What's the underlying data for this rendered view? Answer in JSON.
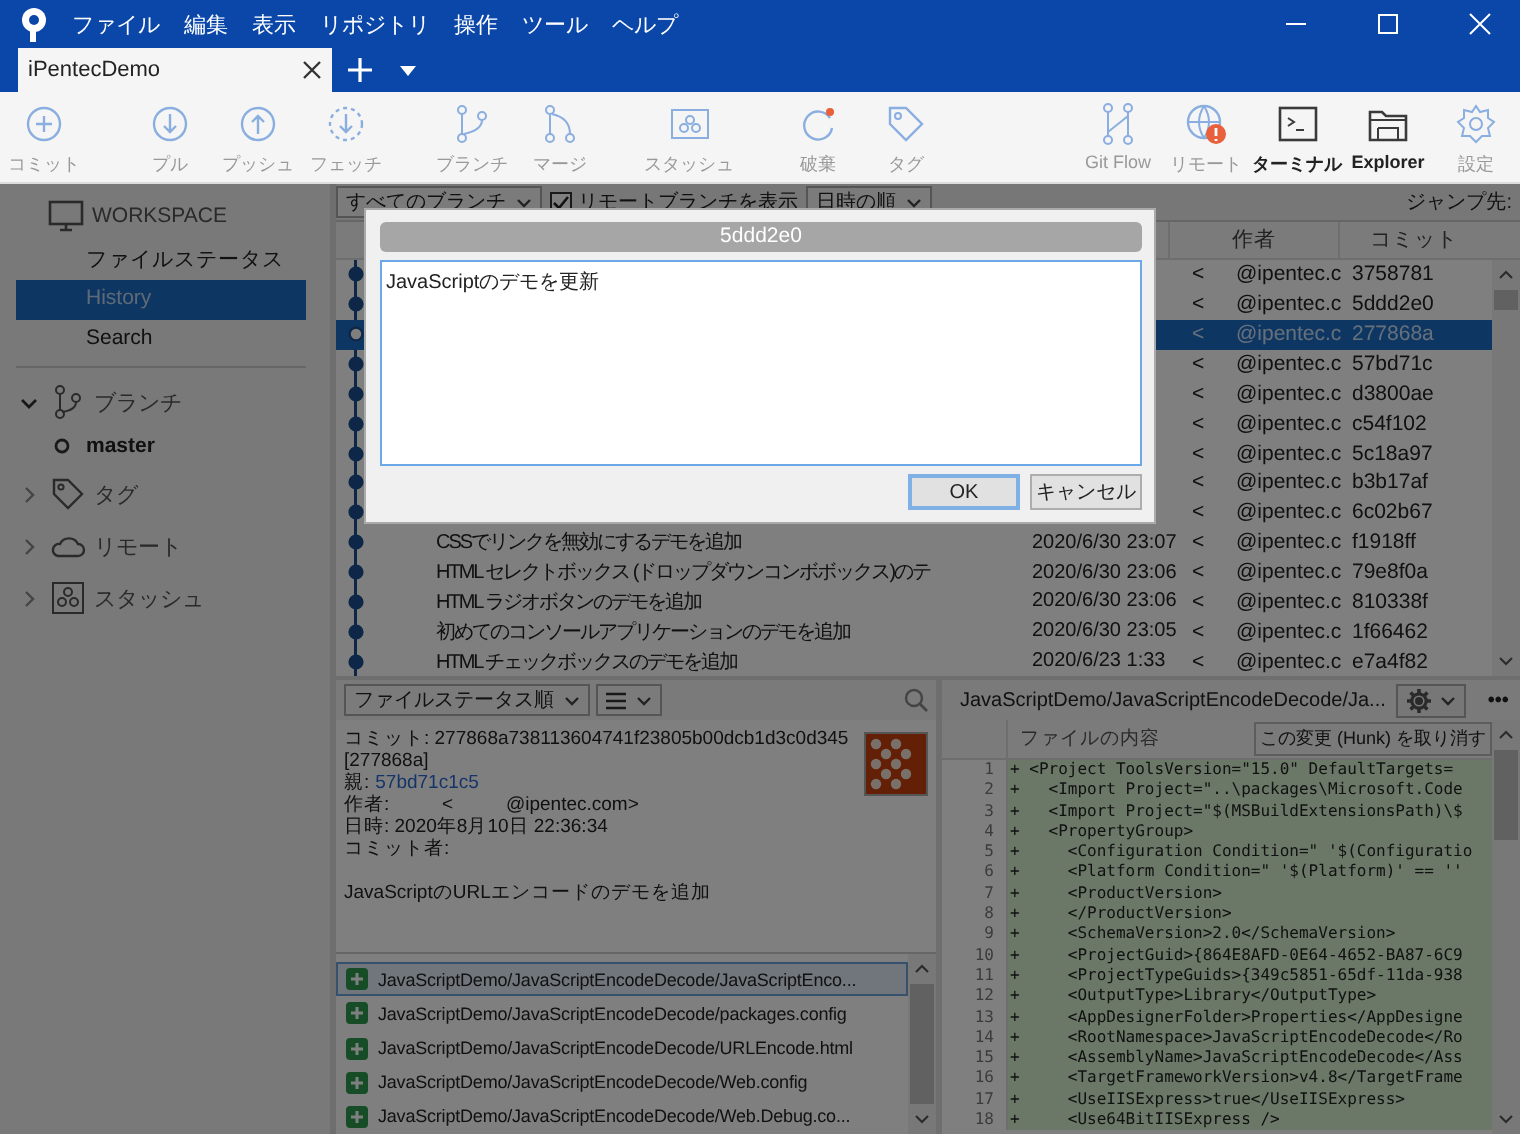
{
  "window": {
    "menu": [
      "ファイル",
      "編集",
      "表示",
      "リポジトリ",
      "操作",
      "ツール",
      "ヘルプ"
    ],
    "tabs": [
      {
        "label": "iPentecDemo",
        "selected": true
      }
    ]
  },
  "toolbar": {
    "left_groups": [
      [
        {
          "label": "コミット",
          "disabled": true
        }
      ],
      [
        {
          "label": "プル",
          "disabled": true
        },
        {
          "label": "プッシュ",
          "disabled": true
        },
        {
          "label": "フェッチ",
          "disabled": true
        }
      ],
      [
        {
          "label": "ブランチ",
          "disabled": true
        },
        {
          "label": "マージ",
          "disabled": true
        }
      ],
      [
        {
          "label": "スタッシュ",
          "disabled": true
        }
      ],
      [
        {
          "label": "破棄",
          "disabled": true
        },
        {
          "label": "タグ",
          "disabled": true
        }
      ]
    ],
    "right_groups": [
      [
        {
          "label": "Git Flow",
          "disabled": true
        },
        {
          "label": "リモート",
          "disabled": true
        },
        {
          "label": "ターミナル",
          "disabled": false
        },
        {
          "label": "Explorer",
          "disabled": false
        },
        {
          "label": "設定",
          "disabled": true
        }
      ]
    ]
  },
  "sidebar": {
    "workspace": {
      "label": "WORKSPACE",
      "items": [
        {
          "label": "ファイルステータス",
          "selected": false
        },
        {
          "label": "History",
          "selected": true
        },
        {
          "label": "Search",
          "selected": false
        }
      ]
    },
    "sections": [
      {
        "label": "ブランチ",
        "expanded": true,
        "children": [
          {
            "label": "master"
          }
        ]
      },
      {
        "label": "タグ",
        "expanded": false
      },
      {
        "label": "リモート",
        "expanded": false
      },
      {
        "label": "スタッシュ",
        "expanded": false
      }
    ]
  },
  "history": {
    "branch_filter": "すべてのブランチ",
    "show_remote": {
      "label": "リモートブランチを表示",
      "checked": true
    },
    "sort": "日時の順",
    "jump_label": "ジャンプ先:",
    "columns": [
      "作者",
      "コミット"
    ],
    "rows": [
      {
        "author_mark": "<",
        "author_email": "@ipentec.c",
        "commit": "3758781",
        "selected": false
      },
      {
        "author_mark": "<",
        "author_email": "@ipentec.c",
        "commit": "5ddd2e0",
        "selected": false
      },
      {
        "author_mark": "<",
        "author_email": "@ipentec.c",
        "commit": "277868a",
        "selected": true
      },
      {
        "author_mark": "<",
        "author_email": "@ipentec.c",
        "commit": "57bd71c",
        "selected": false
      },
      {
        "author_mark": "<",
        "author_email": "@ipentec.c",
        "commit": "d3800ae",
        "selected": false
      },
      {
        "author_mark": "<",
        "author_email": "@ipentec.c",
        "commit": "c54f102",
        "selected": false
      },
      {
        "author_mark": "<",
        "author_email": "@ipentec.c",
        "commit": "5c18a97",
        "selected": false
      },
      {
        "author_mark": "<",
        "author_email": "@ipentec.c",
        "commit": "b3b17af",
        "selected": false
      },
      {
        "author_mark": "<",
        "author_email": "@ipentec.c",
        "commit": "6c02b67",
        "selected": false
      },
      {
        "description": "CSSでリンクを無効にするデモを追加",
        "date": "2020/6/30  23:07",
        "author_mark": "<",
        "author_email": "@ipentec.c",
        "commit": "f1918ff",
        "selected": false
      },
      {
        "description": "HTML セレクトボックス (ドロップダウンコンボボックス)のテ",
        "date": "2020/6/30  23:06",
        "author_mark": "<",
        "author_email": "@ipentec.c",
        "commit": "79e8f0a",
        "selected": false
      },
      {
        "description": "HTML ラジオボタンのデモを追加",
        "date": "2020/6/30  23:06",
        "author_mark": "<",
        "author_email": "@ipentec.c",
        "commit": "810338f",
        "selected": false
      },
      {
        "description": "初めてのコンソールアプリケーションのデモを追加",
        "date": "2020/6/30  23:05",
        "author_mark": "<",
        "author_email": "@ipentec.c",
        "commit": "1f66462",
        "selected": false
      },
      {
        "description": "HTML チェックボックスのデモを追加",
        "date": "2020/6/23  1:33",
        "author_mark": "<",
        "author_email": "@ipentec.c",
        "commit": "e7a4f82",
        "selected": false
      }
    ]
  },
  "dialog": {
    "title": "5ddd2e0",
    "message": "JavaScriptのデモを更新",
    "buttons": [
      {
        "label": "OK",
        "default": true
      },
      {
        "label": "キャンセル",
        "default": false
      }
    ]
  },
  "details": {
    "sort": "ファイルステータス順",
    "commit_line": "コミット: 277868a738113604741f23805b00dcb1d3c0d345",
    "short_hash": "[277868a]",
    "parent_label": "親:",
    "parent_link": "57bd71c1c5",
    "author_line": "作者:          <          @ipentec.com>",
    "date_line": "日時: 2020年8月10日 22:36:34",
    "committer_line": "コミット者:",
    "message": "JavaScriptのURLエンコードのデモを追加",
    "files": [
      {
        "path": "JavaScriptDemo/JavaScriptEncodeDecode/JavaScriptEnco...",
        "selected": true
      },
      {
        "path": "JavaScriptDemo/JavaScriptEncodeDecode/packages.config",
        "selected": false
      },
      {
        "path": "JavaScriptDemo/JavaScriptEncodeDecode/URLEncode.html",
        "selected": false
      },
      {
        "path": "JavaScriptDemo/JavaScriptEncodeDecode/Web.config",
        "selected": false
      },
      {
        "path": "JavaScriptDemo/JavaScriptEncodeDecode/Web.Debug.co...",
        "selected": false
      }
    ]
  },
  "diff": {
    "path": "JavaScriptDemo/JavaScriptEncodeDecode/Ja...",
    "more": "•••",
    "content_label": "ファイルの内容",
    "discard_button": "この変更 (Hunk) を取り消す",
    "lines": [
      {
        "number": "1",
        "mark": "+",
        "text": "<Project ToolsVersion=\"15.0\" DefaultTargets="
      },
      {
        "number": "2",
        "mark": "+",
        "text": "  <Import Project=\"..\\packages\\Microsoft.Code"
      },
      {
        "number": "3",
        "mark": "+",
        "text": "  <Import Project=\"$(MSBuildExtensionsPath)\\$"
      },
      {
        "number": "4",
        "mark": "+",
        "text": "  <PropertyGroup>"
      },
      {
        "number": "5",
        "mark": "+",
        "text": "    <Configuration Condition=\" '$(Configuratio"
      },
      {
        "number": "6",
        "mark": "+",
        "text": "    <Platform Condition=\" '$(Platform)' == ''"
      },
      {
        "number": "7",
        "mark": "+",
        "text": "    <ProductVersion>"
      },
      {
        "number": "8",
        "mark": "+",
        "text": "    </ProductVersion>"
      },
      {
        "number": "9",
        "mark": "+",
        "text": "    <SchemaVersion>2.0</SchemaVersion>"
      },
      {
        "number": "10",
        "mark": "+",
        "text": "    <ProjectGuid>{864E8AFD-0E64-4652-BA87-6C9"
      },
      {
        "number": "11",
        "mark": "+",
        "text": "    <ProjectTypeGuids>{349c5851-65df-11da-938"
      },
      {
        "number": "12",
        "mark": "+",
        "text": "    <OutputType>Library</OutputType>"
      },
      {
        "number": "13",
        "mark": "+",
        "text": "    <AppDesignerFolder>Properties</AppDesigne"
      },
      {
        "number": "14",
        "mark": "+",
        "text": "    <RootNamespace>JavaScriptEncodeDecode</Ro"
      },
      {
        "number": "15",
        "mark": "+",
        "text": "    <AssemblyName>JavaScriptEncodeDecode</Ass"
      },
      {
        "number": "16",
        "mark": "+",
        "text": "    <TargetFrameworkVersion>v4.8</TargetFrame"
      },
      {
        "number": "17",
        "mark": "+",
        "text": "    <UseIISExpress>true</UseIISExpress>"
      },
      {
        "number": "18",
        "mark": "+",
        "text": "    <Use64BitIISExpress />"
      }
    ]
  }
}
